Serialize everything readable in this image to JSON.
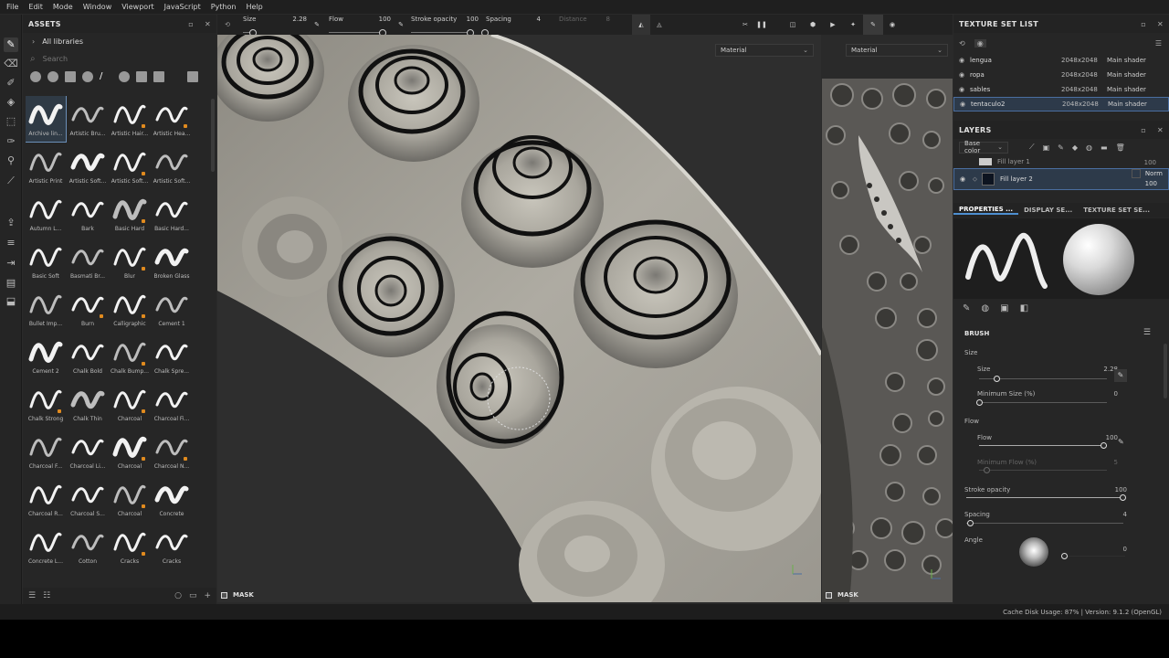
{
  "menu": [
    "File",
    "Edit",
    "Mode",
    "Window",
    "Viewport",
    "JavaScript",
    "Python",
    "Help"
  ],
  "assets": {
    "title": "ASSETS",
    "library": "All libraries",
    "search_placeholder": "Search",
    "brushes": [
      "Archive lin...",
      "Artistic Bru...",
      "Artistic Hair...",
      "Artistic Hea...",
      "Artistic Print",
      "Artistic Soft...",
      "Artistic Soft...",
      "Artistic Soft...",
      "Autumn L...",
      "Bark",
      "Basic Hard",
      "Basic Hard...",
      "Basic Soft",
      "Basmati Br...",
      "Blur",
      "Broken Glass",
      "Bullet Imp...",
      "Burn",
      "Calligraphic",
      "Cement 1",
      "Cement 2",
      "Chalk Bold",
      "Chalk Bump...",
      "Chalk Spre...",
      "Chalk Strong",
      "Chalk Thin",
      "Charcoal",
      "Charcoal Fi...",
      "Charcoal F...",
      "Charcoal Li...",
      "Charcoal",
      "Charcoal N...",
      "Charcoal R...",
      "Charcoal S...",
      "Charcoal",
      "Concrete",
      "Concrete L...",
      "Cotton",
      "Cracks",
      "Cracks"
    ]
  },
  "toolbar": {
    "size_label": "Size",
    "size_value": "2.28",
    "flow_label": "Flow",
    "flow_value": "100",
    "stroke_label": "Stroke opacity",
    "stroke_value": "100",
    "spacing_label": "Spacing",
    "spacing_value": "4",
    "distance_label": "Distance",
    "distance_value": "8"
  },
  "viewport3d": {
    "material": "Material",
    "mask": "MASK"
  },
  "viewport2d": {
    "material": "Material",
    "mask": "MASK"
  },
  "texture_set_list": {
    "title": "TEXTURE SET LIST",
    "rows": [
      {
        "name": "lengua",
        "res": "2048x2048",
        "shader": "Main shader"
      },
      {
        "name": "ropa",
        "res": "2048x2048",
        "shader": "Main shader"
      },
      {
        "name": "sables",
        "res": "2048x2048",
        "shader": "Main shader"
      },
      {
        "name": "tentaculo2",
        "res": "2048x2048",
        "shader": "Main shader"
      }
    ]
  },
  "layers": {
    "title": "LAYERS",
    "channel": "Base color",
    "rows": [
      {
        "name": "Fill layer 1",
        "opacity": "100"
      },
      {
        "name": "Fill layer 2",
        "blend": "Norm",
        "opacity": "100"
      }
    ]
  },
  "properties": {
    "tabs": [
      "PROPERTIES ...",
      "DISPLAY SE...",
      "TEXTURE SET SE..."
    ],
    "brush_title": "BRUSH",
    "size_section": "Size",
    "size_label": "Size",
    "size_value": "2.28",
    "min_size_label": "Minimum Size (%)",
    "min_size_value": "0",
    "flow_section": "Flow",
    "flow_label": "Flow",
    "flow_value": "100",
    "min_flow_label": "Minimum Flow (%)",
    "min_flow_value": "5",
    "stroke_label": "Stroke opacity",
    "stroke_value": "100",
    "spacing_label": "Spacing",
    "spacing_value": "4",
    "angle_label": "Angle",
    "angle_value": "0"
  },
  "status": "Cache Disk Usage:   87% | Version: 9.1.2 (OpenGL)",
  "colors": {
    "accent": "#4d8fd1",
    "selection": "#2d3a4a",
    "orange": "#e08a1e"
  }
}
